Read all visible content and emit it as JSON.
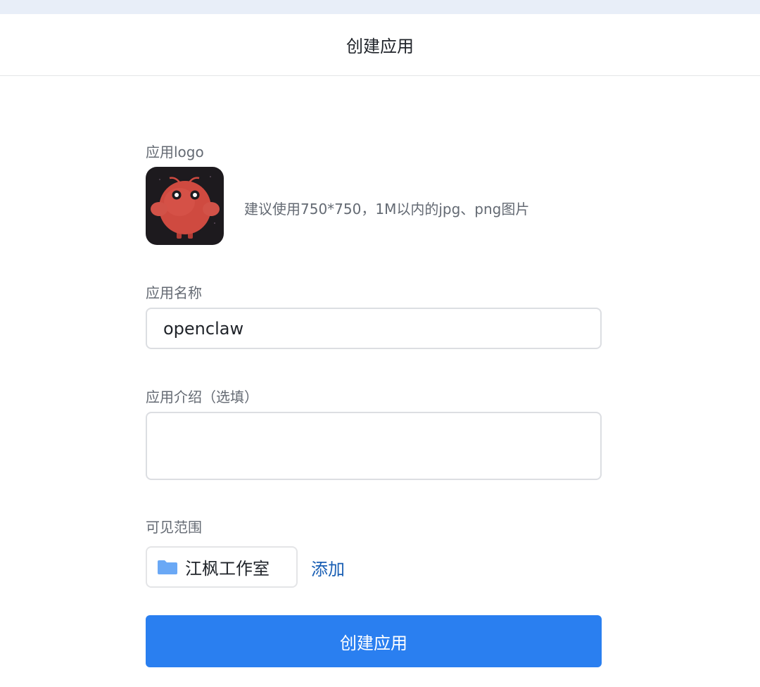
{
  "header": {
    "title": "创建应用"
  },
  "logo_section": {
    "label": "应用logo",
    "icon": "red-monster-app-logo",
    "hint": "建议使用750*750，1M以内的jpg、png图片"
  },
  "name_section": {
    "label": "应用名称",
    "value": "openclaw"
  },
  "description_section": {
    "label": "应用介绍（选填）",
    "value": ""
  },
  "visibility_section": {
    "label": "可见范围",
    "chip": {
      "icon": "folder-icon",
      "text": "江枫工作室"
    },
    "add_label": "添加"
  },
  "submit": {
    "label": "创建应用"
  },
  "colors": {
    "primary": "#2a7ff0",
    "link": "#1a5fb4",
    "folder": "#6aa8f5",
    "logo_bg": "#1d1a1e",
    "logo_body": "#cf4a40"
  }
}
